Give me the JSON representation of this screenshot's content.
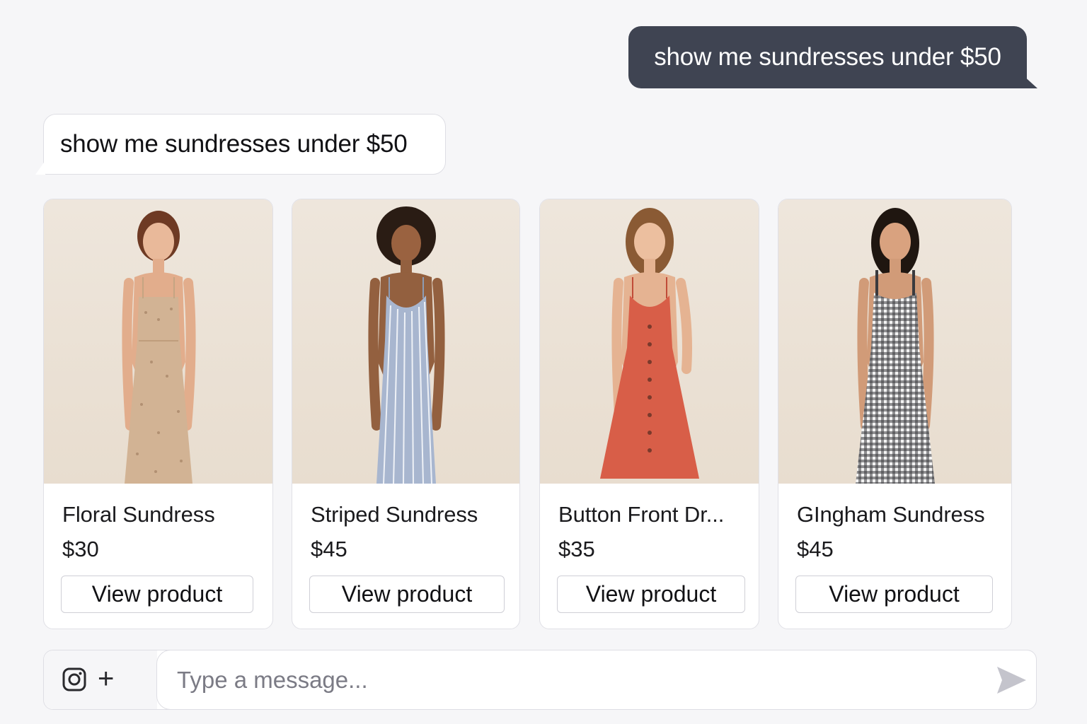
{
  "conversation": {
    "user_message": "show me sundresses under $50",
    "bot_message": "show me sundresses under $50"
  },
  "products": [
    {
      "name": "Floral Sundress",
      "price": "$30",
      "button_label": "View product",
      "dress_color": "#d2b394",
      "pattern": "floral"
    },
    {
      "name": "Striped Sundress",
      "price": "$45",
      "button_label": "View product",
      "dress_color": "#a8b6cf",
      "pattern": "striped"
    },
    {
      "name": "Button Front Dr...",
      "price": "$35",
      "button_label": "View product",
      "dress_color": "#d85e48",
      "pattern": "button-front"
    },
    {
      "name": "GIngham Sundress",
      "price": "$45",
      "button_label": "View product",
      "dress_color": "#3a3a3e",
      "pattern": "gingham"
    }
  ],
  "composer": {
    "placeholder": "Type a message...",
    "attach_icon": "instagram-icon",
    "add_icon": "plus-icon",
    "send_icon": "send-icon"
  },
  "colors": {
    "user_bubble": "#3f4452",
    "background": "#f6f6f8"
  }
}
